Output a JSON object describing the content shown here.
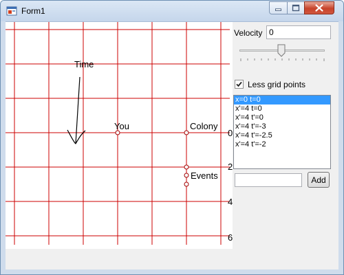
{
  "window": {
    "title": "Form1"
  },
  "colors": {
    "grid_line": "#cc0000",
    "selection": "#3399ff",
    "window_frame": "#cfdcec",
    "client_bg": "#f0f0f0"
  },
  "icons": {
    "app": "form-app-icon",
    "minimize": "minimize-icon",
    "maximize": "maximize-icon",
    "close": "close-icon"
  },
  "diagram": {
    "time_label": "Time",
    "axis_labels": [
      "0",
      "2",
      "4",
      "6"
    ],
    "points": [
      {
        "name": "you",
        "label": "You"
      },
      {
        "name": "colony",
        "label": "Colony"
      },
      {
        "name": "events",
        "label": "Events"
      }
    ]
  },
  "controls": {
    "velocity_label": "Velocity",
    "velocity_value": "0",
    "velocity_slider_fraction": 0.5,
    "less_grid_label": "Less grid points",
    "less_grid_checked": true,
    "list_items": [
      "x=0 t=0",
      "x'=4 t=0",
      "x'=4 t'=0",
      "x'=4 t'=-3",
      "x'=4 t'=-2.5",
      "x'=4 t'=-2"
    ],
    "selected_index": 0,
    "new_item_value": "",
    "add_label": "Add"
  }
}
